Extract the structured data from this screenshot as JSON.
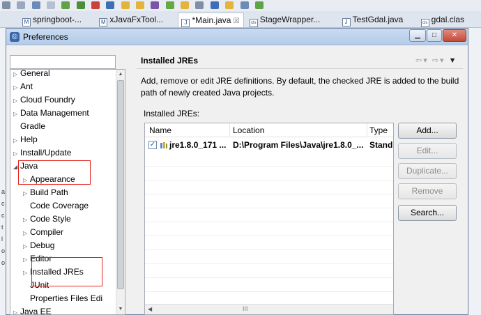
{
  "ide": {
    "editor_tabs": [
      {
        "label": "springboot-...",
        "icon": "M"
      },
      {
        "label": "xJavaFxTool...",
        "icon": "M"
      },
      {
        "label": "*Main.java",
        "icon": "J",
        "close": "☒",
        "active": true
      },
      {
        "label": "StageWrapper...",
        "icon": "cls"
      },
      {
        "label": "TestGdal.java",
        "icon": "J"
      },
      {
        "label": "gdal.clas",
        "icon": "cls"
      }
    ],
    "left_strip_chars": [
      "a",
      "c",
      "c",
      "t",
      "l",
      "o",
      "o"
    ]
  },
  "dialog": {
    "title": "Preferences",
    "filter": {
      "value": "",
      "placeholder": ""
    },
    "tree": [
      {
        "label": "General",
        "arrow": "▷",
        "level": 0
      },
      {
        "label": "Ant",
        "arrow": "▷",
        "level": 0
      },
      {
        "label": "Cloud Foundry",
        "arrow": "▷",
        "level": 0
      },
      {
        "label": "Data Management",
        "arrow": "▷",
        "level": 0
      },
      {
        "label": "Gradle",
        "arrow": "",
        "level": 0
      },
      {
        "label": "Help",
        "arrow": "▷",
        "level": 0
      },
      {
        "label": "Install/Update",
        "arrow": "▷",
        "level": 0
      },
      {
        "label": "Java",
        "arrow": "◢",
        "level": 0
      },
      {
        "label": "Appearance",
        "arrow": "▷",
        "level": 1
      },
      {
        "label": "Build Path",
        "arrow": "▷",
        "level": 1
      },
      {
        "label": "Code Coverage",
        "arrow": "",
        "level": 1
      },
      {
        "label": "Code Style",
        "arrow": "▷",
        "level": 1
      },
      {
        "label": "Compiler",
        "arrow": "▷",
        "level": 1
      },
      {
        "label": "Debug",
        "arrow": "▷",
        "level": 1
      },
      {
        "label": "Editor",
        "arrow": "▷",
        "level": 1
      },
      {
        "label": "Installed JREs",
        "arrow": "▷",
        "level": 1
      },
      {
        "label": "JUnit",
        "arrow": "",
        "level": 1
      },
      {
        "label": "Properties Files Edi",
        "arrow": "",
        "level": 1
      },
      {
        "label": "Java EE",
        "arrow": "▷",
        "level": 0
      }
    ],
    "page": {
      "title": "Installed JREs",
      "description": "Add, remove or edit JRE definitions. By default, the checked JRE is added to the build path of newly created Java projects.",
      "list_label": "Installed JREs:",
      "columns": [
        "Name",
        "Location",
        "Type"
      ],
      "rows": [
        {
          "checked": true,
          "name": "jre1.8.0_171 ...",
          "location": "D:\\Program Files\\Java\\jre1.8.0_...",
          "type": "Stand"
        }
      ],
      "hscroll_grip": "III",
      "buttons": {
        "add": "Add...",
        "edit": "Edit...",
        "duplicate": "Duplicate...",
        "remove": "Remove",
        "search": "Search..."
      }
    }
  },
  "colors": {
    "highlight_box": "#e3201b",
    "title_gradient": "#c8dbf1",
    "close_button": "#c44a36"
  }
}
